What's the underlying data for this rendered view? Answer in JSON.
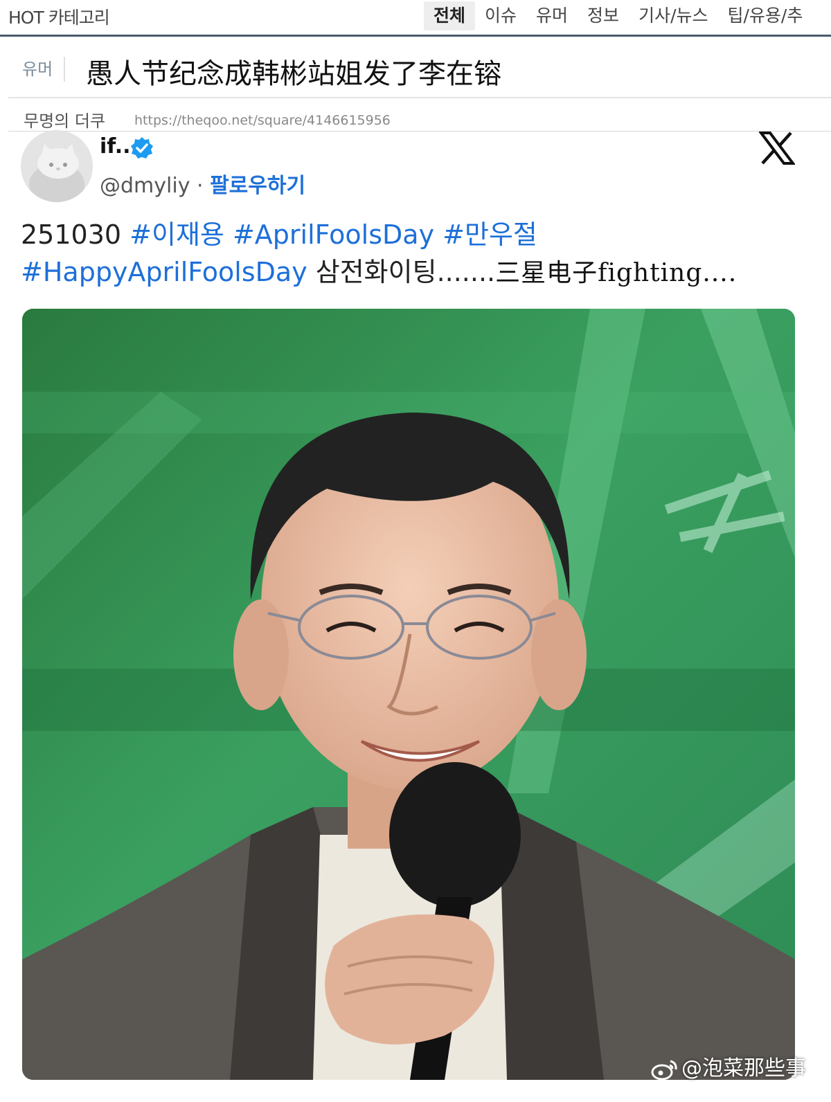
{
  "category_bar": {
    "label": "HOT 카테고리",
    "tabs": [
      "전체",
      "이슈",
      "유머",
      "정보",
      "기사/뉴스",
      "팁/유용/추"
    ],
    "active_tab": "전체"
  },
  "post": {
    "category": "유머",
    "title": "愚人节纪念成韩彬站姐发了李在镕",
    "author": "무명의 더쿠",
    "url": "https://theqoo.net/square/4146615956"
  },
  "tweet": {
    "display_name": "if..",
    "handle": "@dmyliy",
    "separator": " · ",
    "follow_label": "팔로우하기",
    "text_line1": {
      "date": "251030 ",
      "tags": [
        "#이재용",
        "#AprilFoolsDay",
        "#만우절"
      ]
    },
    "text_line2": {
      "tag": "#HappyAprilFoolsDay",
      "korean": " 삼전화이팅.......",
      "chinese": "三星电子fighting...."
    },
    "icons": {
      "verified": "verified-badge-icon",
      "platform": "x-logo-icon"
    },
    "colors": {
      "link": "#1d6fd8",
      "verified": "#1d9bf0"
    }
  },
  "watermark": {
    "text": "@泡菜那些事",
    "icon": "weibo-icon"
  }
}
